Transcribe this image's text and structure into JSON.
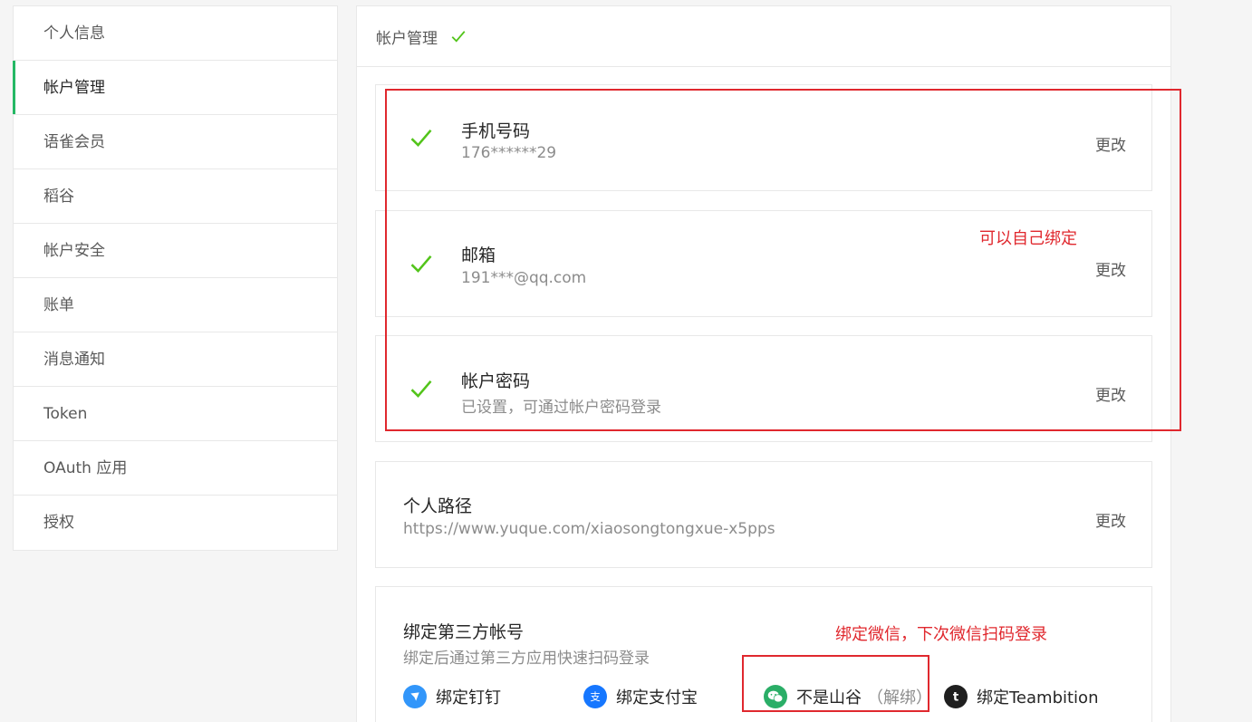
{
  "sidebar": {
    "items": [
      {
        "label": "个人信息"
      },
      {
        "label": "帐户管理"
      },
      {
        "label": "语雀会员"
      },
      {
        "label": "稻谷"
      },
      {
        "label": "帐户安全"
      },
      {
        "label": "账单"
      },
      {
        "label": "消息通知"
      },
      {
        "label": "Token"
      },
      {
        "label": "OAuth 应用"
      },
      {
        "label": "授权"
      }
    ],
    "active_index": 1
  },
  "header": {
    "title": "帐户管理"
  },
  "phone": {
    "title": "手机号码",
    "value": "176******29",
    "action": "更改"
  },
  "email": {
    "title": "邮箱",
    "value": "191***@qq.com",
    "action": "更改"
  },
  "password": {
    "title": "帐户密码",
    "value": "已设置，可通过帐户密码登录",
    "action": "更改"
  },
  "path": {
    "title": "个人路径",
    "value": "https://www.yuque.com/xiaosongtongxue-x5pps",
    "action": "更改"
  },
  "third_party": {
    "title": "绑定第三方帐号",
    "subtitle": "绑定后通过第三方应用快速扫码登录",
    "items": [
      {
        "label": "绑定钉钉",
        "icon": "dingtalk-icon"
      },
      {
        "label": "绑定支付宝",
        "icon": "alipay-icon"
      },
      {
        "label": "不是山谷",
        "unbind": "（解绑）",
        "icon": "wechat-icon"
      },
      {
        "label": "绑定Teambition",
        "icon": "teambition-icon"
      }
    ]
  },
  "annotations": {
    "note1": "可以自己绑定",
    "note2": "绑定微信，下次微信扫码登录"
  },
  "colors": {
    "accent": "#25b864",
    "check": "#52c41a",
    "annotation": "#e0282e"
  }
}
